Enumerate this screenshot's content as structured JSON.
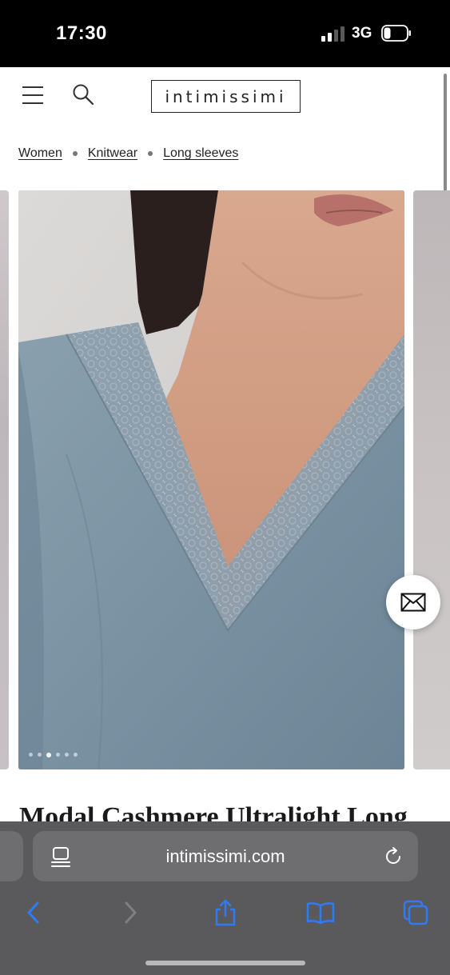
{
  "status_bar": {
    "time": "17:30",
    "network": "3G",
    "signal_bars_active": 2,
    "signal_bars_total": 4,
    "battery_level": 0.25
  },
  "header": {
    "logo_text": "intimissimi",
    "menu_icon": "hamburger-menu-icon",
    "search_icon": "search-icon"
  },
  "breadcrumb": {
    "items": [
      {
        "label": "Women"
      },
      {
        "label": "Knitwear"
      },
      {
        "label": "Long sleeves"
      }
    ]
  },
  "gallery": {
    "total_images": 6,
    "active_index": 2,
    "product_color": "#7890a0"
  },
  "floating_button": {
    "icon": "mail-icon"
  },
  "product": {
    "title": "Modal Cashmere Ultralight Long"
  },
  "browser": {
    "url": "intimissimi.com",
    "page_icon": "page-menu-icon",
    "reload_icon": "reload-icon",
    "toolbar": [
      {
        "icon": "back-icon",
        "enabled": true
      },
      {
        "icon": "forward-icon",
        "enabled": false
      },
      {
        "icon": "share-icon",
        "enabled": true
      },
      {
        "icon": "bookmarks-icon",
        "enabled": true
      },
      {
        "icon": "tabs-icon",
        "enabled": true
      }
    ],
    "accent_color": "#2f7bf6"
  }
}
